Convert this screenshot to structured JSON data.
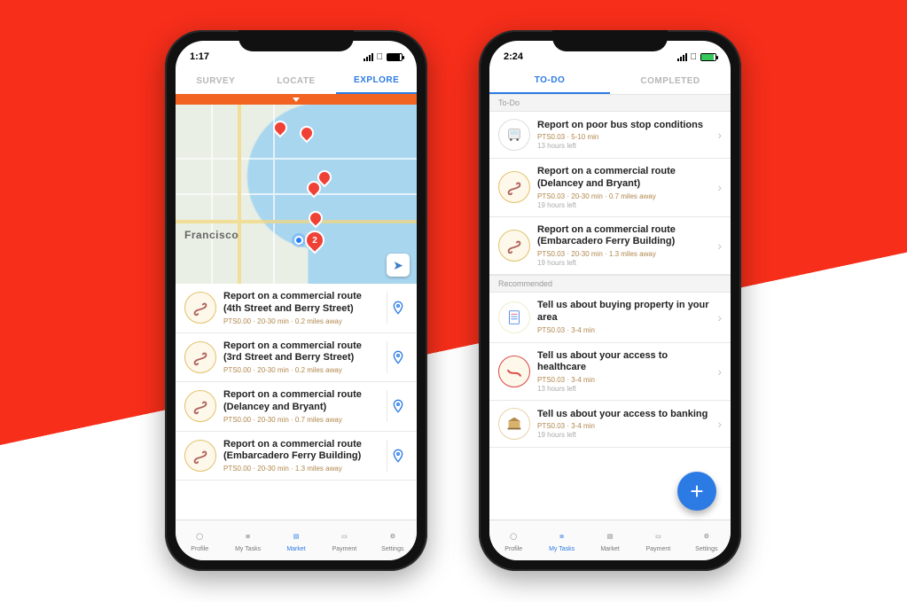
{
  "phone_left": {
    "status_time": "1:17",
    "tabs": {
      "survey": "SURVEY",
      "locate": "LOCATE",
      "explore": "EXPLORE"
    },
    "map": {
      "city_label": "Francisco",
      "badge": "2"
    },
    "rows": [
      {
        "title": "Report on a commercial route (4th Street and Berry Street)",
        "meta": "PTS0.00 · 20-30 min · 0.2 miles away"
      },
      {
        "title": "Report on a commercial route (3rd Street and Berry Street)",
        "meta": "PTS0.00 · 20-30 min · 0.2 miles away"
      },
      {
        "title": "Report on a commercial route (Delancey and Bryant)",
        "meta": "PTS0.00 · 20-30 min · 0.7 miles away"
      },
      {
        "title": "Report on a commercial route (Embarcadero Ferry Building)",
        "meta": "PTS0.00 · 20-30 min · 1.3 miles away"
      }
    ],
    "tabbar": {
      "profile": "Profile",
      "mytasks": "My Tasks",
      "market": "Market",
      "payment": "Payment",
      "settings": "Settings"
    }
  },
  "phone_right": {
    "status_time": "2:24",
    "tabs": {
      "todo": "TO-DO",
      "completed": "COMPLETED"
    },
    "sections": {
      "todo": "To-Do",
      "recommended": "Recommended"
    },
    "todo": [
      {
        "title": "Report on poor bus stop conditions",
        "meta": "PTS0.03 · 5-10 min",
        "time": "13 hours left"
      },
      {
        "title": "Report on a commercial route (Delancey and Bryant)",
        "meta": "PTS0.03 · 20-30 min · 0.7 miles away",
        "time": "19 hours left"
      },
      {
        "title": "Report on a commercial route (Embarcadero Ferry Building)",
        "meta": "PTS0.03 · 20-30 min · 1.3 miles away",
        "time": "19 hours left"
      }
    ],
    "recommended": [
      {
        "title": "Tell us about buying property in your area",
        "meta": "PTS0.03 · 3-4 min",
        "time": ""
      },
      {
        "title": "Tell us about your access to healthcare",
        "meta": "PTS0.03 · 3-4 min",
        "time": "13 hours left"
      },
      {
        "title": "Tell us about your access to banking",
        "meta": "PTS0.03 · 3-4 min",
        "time": "19 hours left"
      }
    ],
    "fab": "+",
    "tabbar": {
      "profile": "Profile",
      "mytasks": "My Tasks",
      "market": "Market",
      "payment": "Payment",
      "settings": "Settings"
    }
  }
}
